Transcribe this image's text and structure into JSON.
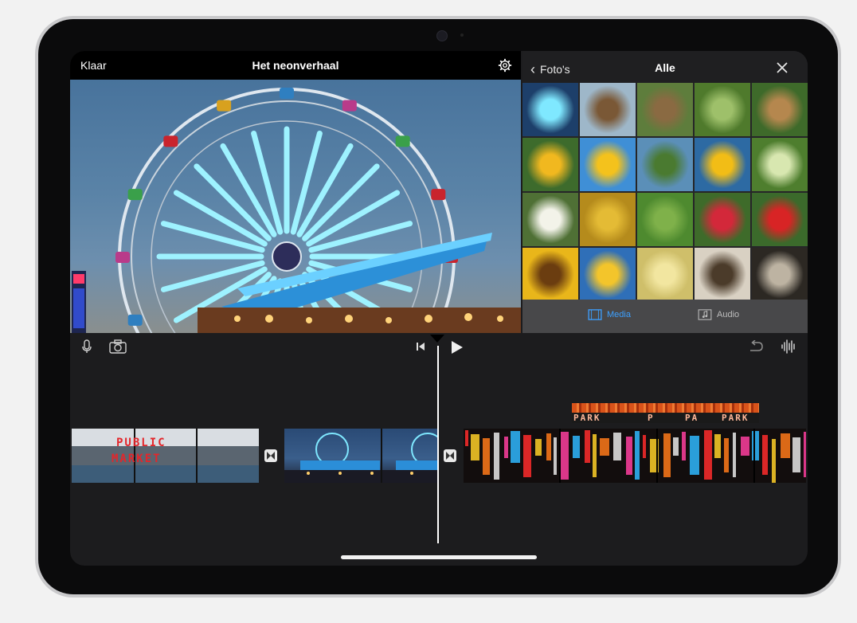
{
  "project": {
    "done_label": "Klaar",
    "title": "Het neonverhaal"
  },
  "browser": {
    "back_label": "Foto's",
    "title": "Alle",
    "tabs": [
      {
        "label": "Media",
        "icon": "film-icon",
        "active": true
      },
      {
        "label": "Audio",
        "icon": "music-note-icon",
        "active": false
      }
    ],
    "thumbnails": [
      "ferris-wheel",
      "raised-garden-bed",
      "garden-planter",
      "green-leafy-plant",
      "garden-plants",
      "sunflower-person",
      "sunflower-blue-sky",
      "sunflowers-garden",
      "sunflower-close-up",
      "striped-squash",
      "chamomile-flowers",
      "sunflower-seeds-macro",
      "green-leaf",
      "rosehip-berry",
      "strawberry",
      "sunflower-blooms",
      "sunflower-blue-sky-2",
      "dried-petals",
      "sunflower-seed",
      "seed-pile"
    ]
  },
  "timeline": {
    "audio_clip_text": [
      "PARK",
      "P",
      "PA",
      "PARK"
    ],
    "clips": [
      {
        "name": "public-market",
        "text": [
          "PUBLIC",
          "MARKET"
        ]
      },
      {
        "name": "ferris-wheel-night"
      },
      {
        "name": "neon-street"
      }
    ],
    "tools": [
      "microphone-icon",
      "camera-icon",
      "skip-back-icon",
      "play-icon",
      "undo-icon",
      "waveform-icon"
    ]
  },
  "colors": {
    "accent": "#3da0ff",
    "screen_bg": "#1c1c1e",
    "neon_blue": "#6ee7ff"
  }
}
